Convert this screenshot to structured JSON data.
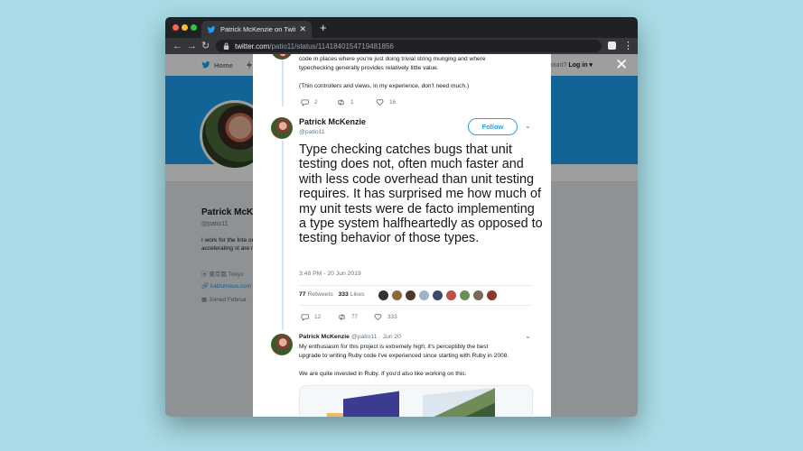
{
  "browser": {
    "tab_title": "Patrick McKenzie on Twitter: \"T",
    "new_tab": "+",
    "url_host": "twitter.com",
    "url_path": "/patio11/status/1141840154719481856"
  },
  "page": {
    "nav_home": "Home",
    "account_text": "ount?",
    "login_label": "Log in ▾",
    "close_symbol": "✕"
  },
  "profile": {
    "name": "Patrick McK",
    "handle": "@patio11",
    "bio": "I work for the Inte on accelerating st are my own.",
    "location": "東京都 Tokyo",
    "link": "kalzumeus.com",
    "joined": "Joined Februa"
  },
  "prev_tweet": {
    "line1": "code in places where you're just doing trivial string munging and where",
    "line2": "typechecking generally provides relatively little value.",
    "line3": "(Thin controllers and views, in my experience, don't need much.)",
    "replies": "2",
    "retweets": "1",
    "likes": "16"
  },
  "main_tweet": {
    "name": "Patrick McKenzie",
    "handle": "@patio11",
    "follow_label": "Follow",
    "text": "Type checking catches bugs that unit testing does not, often much faster and with less code overhead than unit testing requires. It has surprised me how much of my unit tests were de facto implementing a type system halfheartedly as opposed to testing behavior of those types.",
    "timestamp": "3:48 PM - 20 Jun 2019",
    "retweet_count": "77",
    "retweet_label": "Retweets",
    "like_count": "333",
    "like_label": "Likes",
    "replies": "12",
    "retweets": "77",
    "likes": "333"
  },
  "reply_tweet": {
    "name": "Patrick McKenzie",
    "meta": "@patio11 · Jun 20",
    "line1": "My enthusiasm for this project is extremely high; it's perceptibly the best",
    "line2": "upgrade to writing Ruby code I've experienced since starting with Ruby in 2008.",
    "line3": "We are quite invested in Ruby. If you'd also like working on this:"
  },
  "colors": {
    "twitter_blue": "#1da1f2",
    "backdrop": "#a9dce6"
  }
}
